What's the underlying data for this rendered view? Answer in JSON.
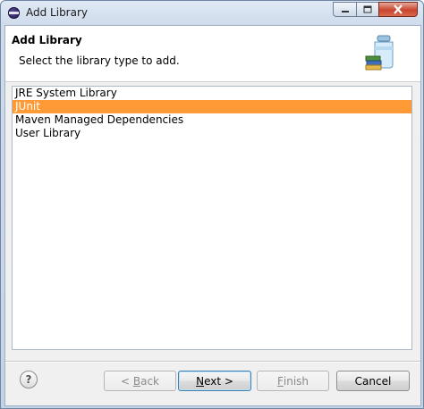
{
  "window": {
    "title": "Add Library",
    "controls": {
      "minimize_icon": "minimize-icon",
      "maximize_icon": "maximize-icon",
      "close_icon": "close-icon"
    }
  },
  "banner": {
    "title": "Add Library",
    "description": "Select the library type to add.",
    "icon": "library-jar-icon"
  },
  "library_types": [
    {
      "label": "JRE System Library",
      "selected": false
    },
    {
      "label": "JUnit",
      "selected": true
    },
    {
      "label": "Maven Managed Dependencies",
      "selected": false
    },
    {
      "label": "User Library",
      "selected": false
    }
  ],
  "footer": {
    "help_icon": "help-icon",
    "help_glyph": "?",
    "back": {
      "mnemonic": "B",
      "rest": "ack",
      "prefix": "< ",
      "enabled": false
    },
    "next": {
      "label": "Next >",
      "mnemonic": "N",
      "rest": "ext >",
      "enabled": true,
      "default": true
    },
    "finish": {
      "mnemonic": "F",
      "rest": "inish",
      "enabled": false
    },
    "cancel": {
      "label": "Cancel",
      "enabled": true
    }
  },
  "colors": {
    "selection": "#ff9b36",
    "titlebar": "#cfdbeb",
    "dialog_bg": "#f0f0f0"
  }
}
